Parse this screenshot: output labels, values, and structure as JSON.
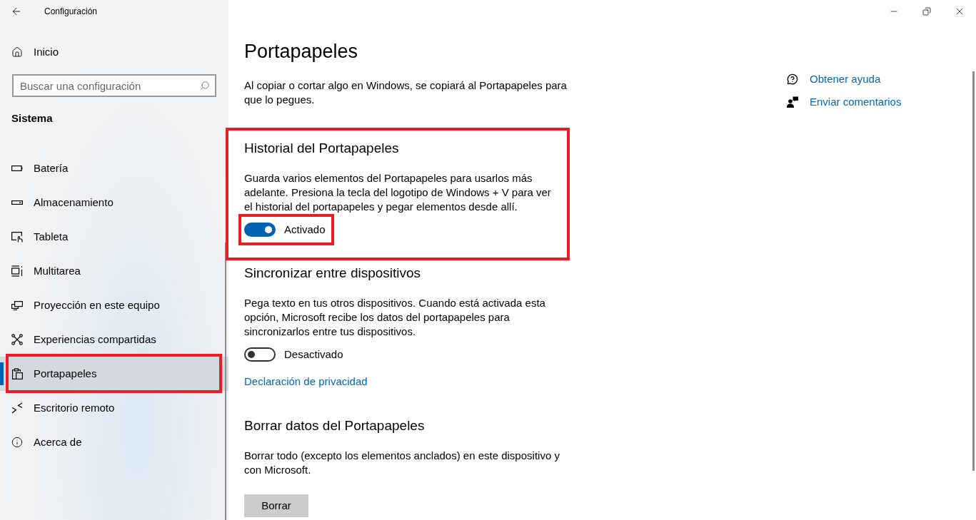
{
  "window": {
    "title": "Configuración"
  },
  "sidebar": {
    "home": "Inicio",
    "search": {
      "placeholder": "Buscar una configuración"
    },
    "section_title": "Sistema",
    "items": [
      {
        "label": "Batería",
        "selected": false,
        "highlighted": false
      },
      {
        "label": "Almacenamiento",
        "selected": false,
        "highlighted": false
      },
      {
        "label": "Tableta",
        "selected": false,
        "highlighted": false
      },
      {
        "label": "Multitarea",
        "selected": false,
        "highlighted": false
      },
      {
        "label": "Proyección en este equipo",
        "selected": false,
        "highlighted": false
      },
      {
        "label": "Experiencias compartidas",
        "selected": false,
        "highlighted": false
      },
      {
        "label": "Portapapeles",
        "selected": true,
        "highlighted": true
      },
      {
        "label": "Escritorio remoto",
        "selected": false,
        "highlighted": false
      },
      {
        "label": "Acerca de",
        "selected": false,
        "highlighted": false
      }
    ]
  },
  "page": {
    "title": "Portapapeles",
    "intro": "Al copiar o cortar algo en Windows, se copiará al Portapapeles para que lo pegues.",
    "sections": [
      {
        "heading": "Historial del Portapapeles",
        "description": "Guarda varios elementos del Portapapeles para usarlos más adelante. Presiona la tecla del logotipo de Windows + V para ver el historial del portapapeles y pegar elementos desde allí.",
        "highlighted": true,
        "controls": [
          {
            "kind": "toggle",
            "on": true,
            "label": "Activado",
            "highlighted": true
          }
        ]
      },
      {
        "heading": "Sincronizar entre dispositivos",
        "description": "Pega texto en tus otros dispositivos. Cuando está activada esta opción, Microsoft recibe los datos del portapapeles para sincronizarlos entre tus dispositivos.",
        "highlighted": false,
        "controls": [
          {
            "kind": "toggle",
            "on": false,
            "label": "Desactivado",
            "highlighted": false
          },
          {
            "kind": "link",
            "label": "Declaración de privacidad"
          }
        ]
      },
      {
        "heading": "Borrar datos del Portapapeles",
        "description": "Borrar todo (excepto los elementos anclados) en este dispositivo y con Microsoft.",
        "highlighted": false,
        "controls": [
          {
            "kind": "button",
            "label": "Borrar"
          }
        ]
      }
    ]
  },
  "related_links": [
    {
      "label": "Obtener ayuda"
    },
    {
      "label": "Enviar comentarios"
    }
  ]
}
